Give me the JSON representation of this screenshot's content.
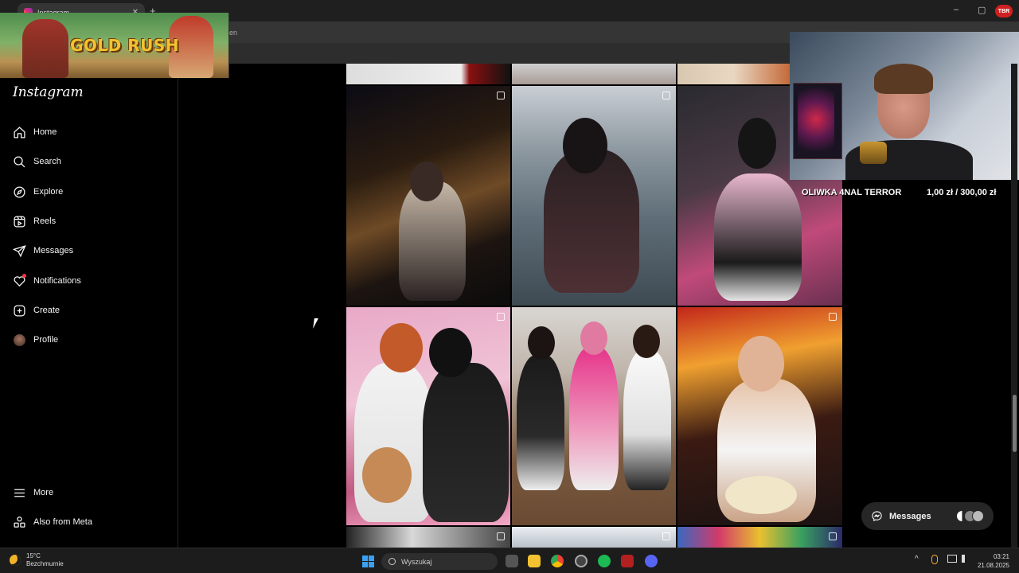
{
  "browser": {
    "tab_title": "Instagram",
    "new_tab": "+",
    "address_fragment": "en",
    "profile_badge": "TBR",
    "window_controls": [
      "–",
      "▢",
      "✕"
    ]
  },
  "overlay": {
    "game_title": "GOLD RUSH"
  },
  "sidebar": {
    "logo": "Instagram",
    "items": [
      {
        "label": "Home",
        "icon": "home-icon"
      },
      {
        "label": "Search",
        "icon": "search-icon"
      },
      {
        "label": "Explore",
        "icon": "compass-icon"
      },
      {
        "label": "Reels",
        "icon": "reels-icon"
      },
      {
        "label": "Messages",
        "icon": "send-icon"
      },
      {
        "label": "Notifications",
        "icon": "heart-icon"
      },
      {
        "label": "Create",
        "icon": "plus-square-icon"
      },
      {
        "label": "Profile",
        "icon": "avatar"
      }
    ],
    "bottom_items": [
      {
        "label": "More",
        "icon": "menu-icon"
      },
      {
        "label": "Also from Meta",
        "icon": "meta-apps-icon"
      }
    ]
  },
  "stream": {
    "donor_name": "OLIWKA 4NAL TERROR",
    "goal": "1,00 zł / 300,00 zł"
  },
  "messages_pill": {
    "label": "Messages"
  },
  "taskbar": {
    "weather_temp": "15°C",
    "weather_desc": "Bezchmurnie",
    "search_placeholder": "Wyszukaj",
    "time": "03:21",
    "date": "21.08.2025",
    "tray_caret": "^"
  }
}
